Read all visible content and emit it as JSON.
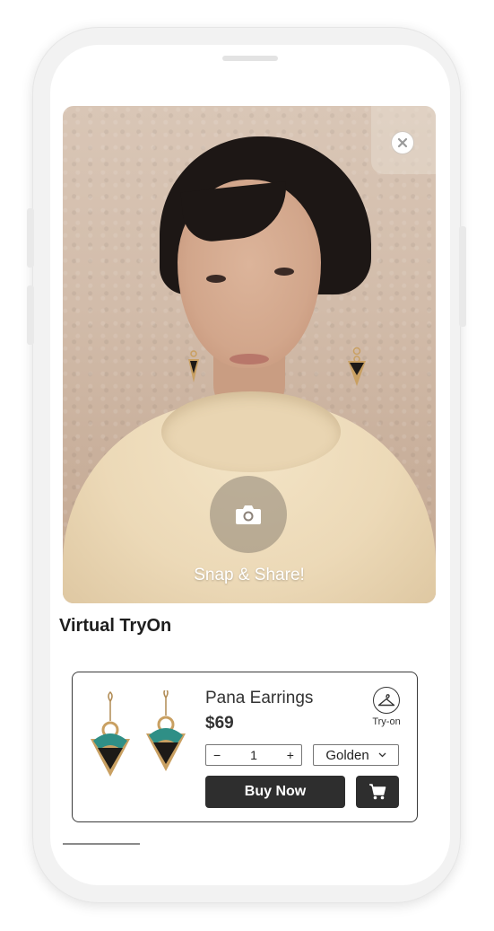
{
  "camera": {
    "snap_label": "Snap & Share!",
    "close_icon": "close-icon",
    "snap_icon": "camera-icon"
  },
  "page": {
    "title": "Virtual TryOn"
  },
  "product": {
    "name": "Pana Earrings",
    "price": "$69",
    "tryon_label": "Try-on",
    "tryon_icon": "hanger-icon",
    "quantity": "1",
    "decrement_label": "−",
    "increment_label": "+",
    "variant": "Golden",
    "buy_label": "Buy Now",
    "cart_icon": "cart-icon"
  },
  "colors": {
    "button_dark": "#2e2e2e",
    "earring_teal": "#2f8f86",
    "earring_gold": "#c9a062"
  }
}
